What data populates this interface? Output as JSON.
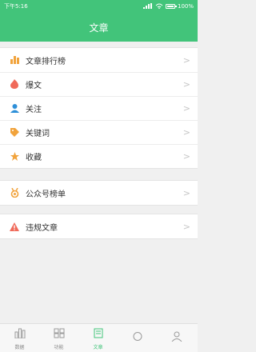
{
  "status_bar": {
    "time": "下午5:16",
    "battery": "100%"
  },
  "header": {
    "title": "文章"
  },
  "groups": [
    {
      "items": [
        {
          "label": "文章排行榜",
          "icon": "bar-chart-icon"
        },
        {
          "label": "爆文",
          "icon": "flame-icon"
        },
        {
          "label": "关注",
          "icon": "person-icon"
        },
        {
          "label": "关键词",
          "icon": "tag-icon"
        },
        {
          "label": "收藏",
          "icon": "star-icon"
        }
      ]
    },
    {
      "items": [
        {
          "label": "公众号榜单",
          "icon": "medal-icon"
        }
      ]
    },
    {
      "items": [
        {
          "label": "违规文章",
          "icon": "warning-icon"
        }
      ]
    }
  ],
  "bottom_nav": [
    {
      "label": "数据",
      "icon": "data-icon"
    },
    {
      "label": "功能",
      "icon": "grid-icon"
    },
    {
      "label": "文章",
      "icon": "article-icon"
    },
    {
      "label": "",
      "icon": "placeholder-icon"
    },
    {
      "label": "",
      "icon": "placeholder-icon"
    }
  ],
  "colors": {
    "accent": "#42c47a",
    "icon_orange": "#f1a33c",
    "icon_red": "#f06a5a",
    "icon_blue": "#2d8fd8"
  }
}
